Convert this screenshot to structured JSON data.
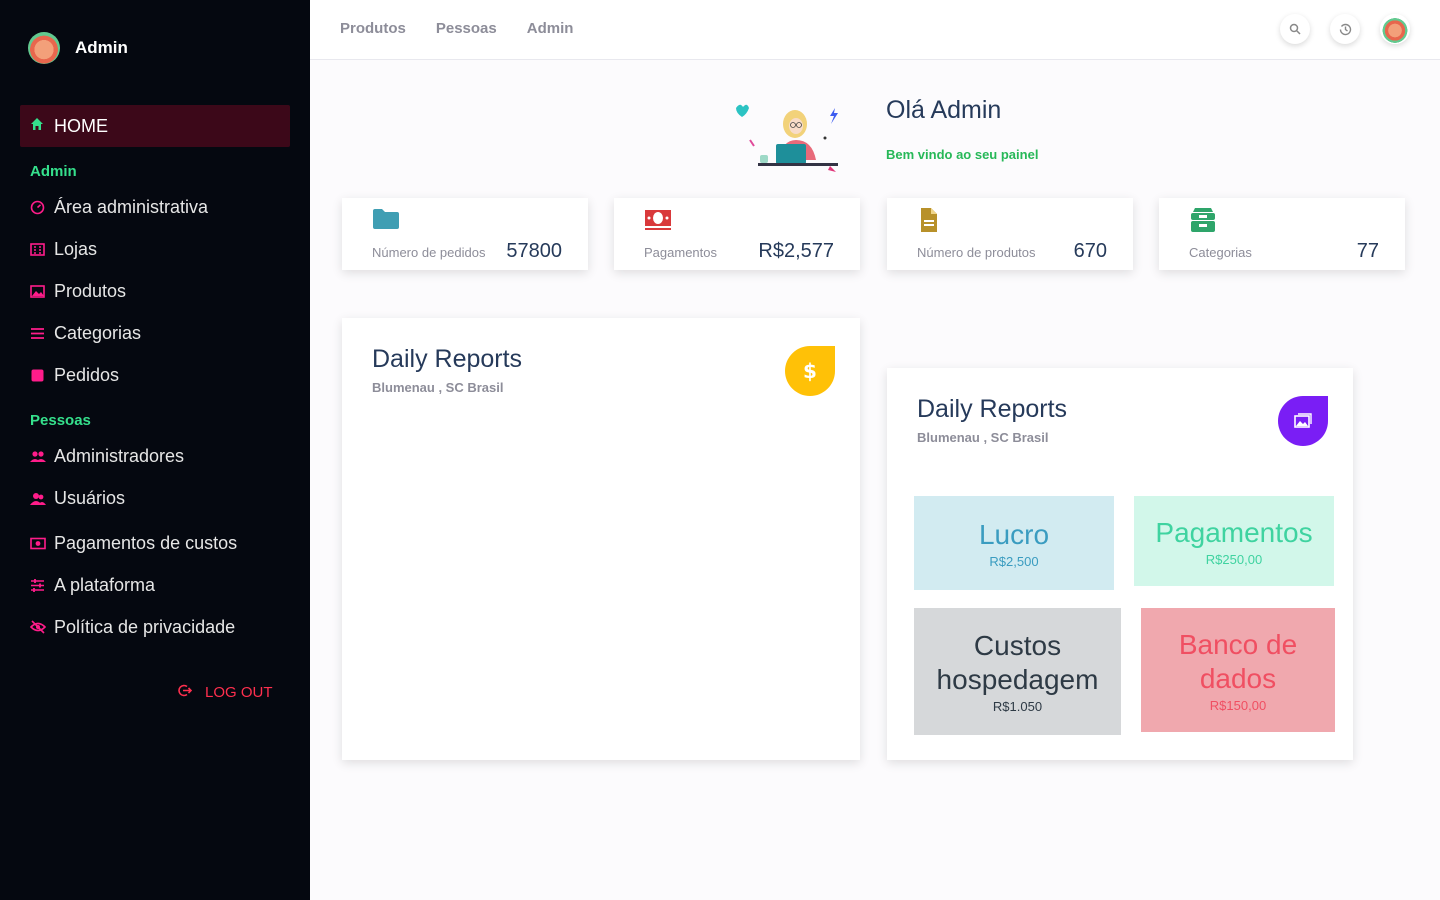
{
  "sidebar": {
    "brand": "Admin",
    "home": "HOME",
    "sections": {
      "admin": "Admin",
      "pessoas": "Pessoas"
    },
    "admin_items": [
      "Área administrativa",
      "Lojas",
      "Produtos",
      "Categorias",
      "Pedidos"
    ],
    "pessoas_items": [
      "Administradores",
      "Usuários"
    ],
    "other_items": [
      "Pagamentos de custos",
      "A plataforma",
      "Política de privacidade"
    ],
    "logout": "LOG OUT"
  },
  "topbar": {
    "nav": [
      "Produtos",
      "Pessoas",
      "Admin"
    ]
  },
  "welcome": {
    "title": "Olá Admin",
    "subtitle": "Bem vindo ao seu painel"
  },
  "stats": [
    {
      "label": "Número de pedidos",
      "value": "57800",
      "icon": "folder-icon",
      "color": "#3f9eb3"
    },
    {
      "label": "Pagamentos",
      "value": "R$2,577",
      "icon": "money-icon",
      "color": "#d9393b"
    },
    {
      "label": "Número de produtos",
      "value": "670",
      "icon": "file-icon",
      "color": "#b8912a"
    },
    {
      "label": "Categorias",
      "value": "77",
      "icon": "archive-icon",
      "color": "#2ea56a"
    }
  ],
  "reports": [
    {
      "title": "Daily Reports",
      "subtitle": "Blumenau , SC Brasil",
      "icon": "$"
    },
    {
      "title": "Daily Reports",
      "subtitle": "Blumenau , SC Brasil",
      "icon": "image-icon"
    }
  ],
  "tiles": [
    {
      "title": "Lucro",
      "value": "R$2,500"
    },
    {
      "title": "Pagamentos",
      "value": "R$250,00"
    },
    {
      "title": "Custos hospedagem",
      "value": "R$1.050"
    },
    {
      "title": "Banco de dados",
      "value": "R$150,00"
    }
  ]
}
